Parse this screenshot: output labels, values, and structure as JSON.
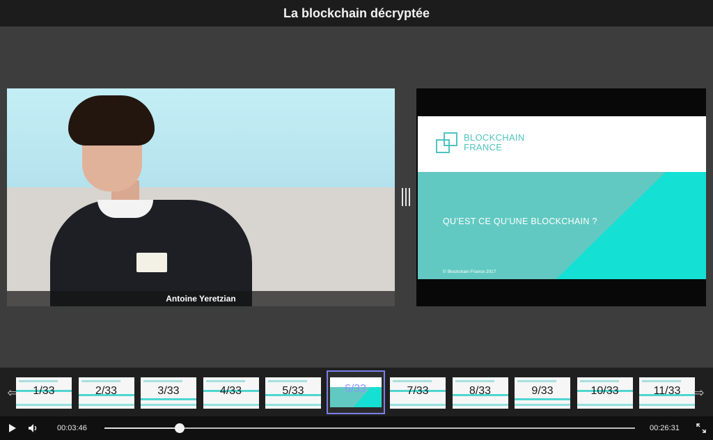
{
  "title": "La blockchain décryptée",
  "speaker": {
    "name": "Antoine Yeretzian"
  },
  "slide": {
    "brand_line1": "BLOCKCHAIN",
    "brand_line2": "FRANCE",
    "heading": "QU’EST CE QU’UNE BLOCKCHAIN ?",
    "footer": "© Blockchain France 2017"
  },
  "thumbnails": [
    {
      "label": "1/33"
    },
    {
      "label": "2/33"
    },
    {
      "label": "3/33"
    },
    {
      "label": "4/33"
    },
    {
      "label": "5/33"
    },
    {
      "label": "6/33",
      "active": true
    },
    {
      "label": "7/33"
    },
    {
      "label": "8/33"
    },
    {
      "label": "9/33"
    },
    {
      "label": "10/33"
    },
    {
      "label": "11/33"
    }
  ],
  "controls": {
    "current_time": "00:03:46",
    "total_time": "00:26:31",
    "progress": 0.142
  },
  "icons": {
    "play": "play-icon",
    "volume": "volume-icon",
    "fullscreen": "fullscreen-icon",
    "prev": "arrow-left-icon",
    "next": "arrow-right-icon",
    "splitter": "resize-handle-icon"
  },
  "colors": {
    "accent": "#62c9c2",
    "accent_bright": "#14e0d4",
    "active_thumb": "#7b7fe8"
  }
}
